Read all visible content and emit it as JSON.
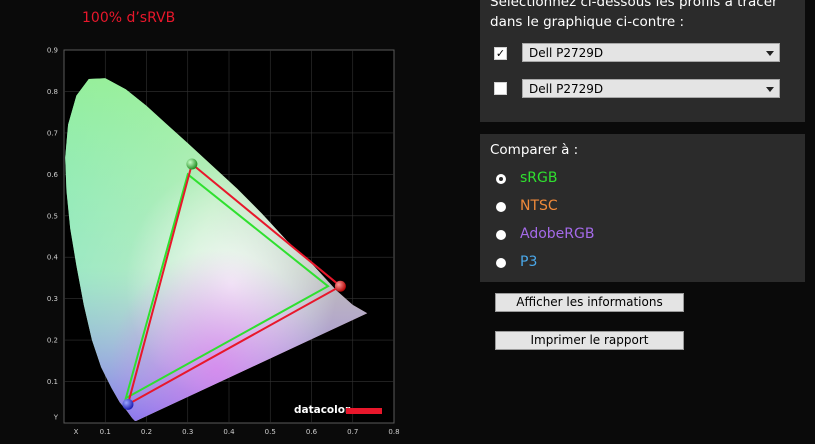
{
  "coverage_label": "100% d’sRVB",
  "colors": {
    "coverage": "#e8172b",
    "srgb": "#2fe02f",
    "ntsc": "#f0893a",
    "adobergb": "#a46ae8",
    "p3": "#4aa8ea",
    "panel": "#2b2b2b",
    "background": "#0a0a0a"
  },
  "chart_data": {
    "type": "scatter",
    "title": "",
    "xlabel": "X",
    "ylabel": "Y",
    "xlim": [
      0,
      0.8
    ],
    "ylim": [
      0,
      0.9
    ],
    "x_ticks": [
      "X",
      "0.1",
      "0.2",
      "0.3",
      "0.4",
      "0.5",
      "0.6",
      "0.7",
      "0.8"
    ],
    "y_ticks": [
      "Y",
      "0.1",
      "0.2",
      "0.3",
      "0.4",
      "0.5",
      "0.6",
      "0.7",
      "0.8",
      "0.9"
    ],
    "series": [
      {
        "name": "Dell P2729D",
        "color": "#e8172b",
        "points": [
          [
            0.67,
            0.33
          ],
          [
            0.31,
            0.625
          ],
          [
            0.155,
            0.045
          ]
        ]
      },
      {
        "name": "sRGB",
        "color": "#2fe02f",
        "points": [
          [
            0.64,
            0.33
          ],
          [
            0.3,
            0.6
          ],
          [
            0.15,
            0.06
          ]
        ]
      }
    ],
    "watermark": "datacolor"
  },
  "profiles": {
    "instruction": "Sélectionnez ci-dessous les profils à tracer dans le graphique ci-contre :",
    "rows": [
      {
        "checked": true,
        "check_glyph": "✓",
        "value": "Dell P2729D"
      },
      {
        "checked": false,
        "check_glyph": "",
        "value": "Dell P2729D"
      }
    ]
  },
  "compare": {
    "heading": "Comparer à :",
    "options": [
      {
        "label": "sRGB",
        "selected": true
      },
      {
        "label": "NTSC",
        "selected": false
      },
      {
        "label": "AdobeRGB",
        "selected": false
      },
      {
        "label": "P3",
        "selected": false
      }
    ]
  },
  "buttons": {
    "info": "Afficher les informations",
    "print": "Imprimer le rapport"
  }
}
